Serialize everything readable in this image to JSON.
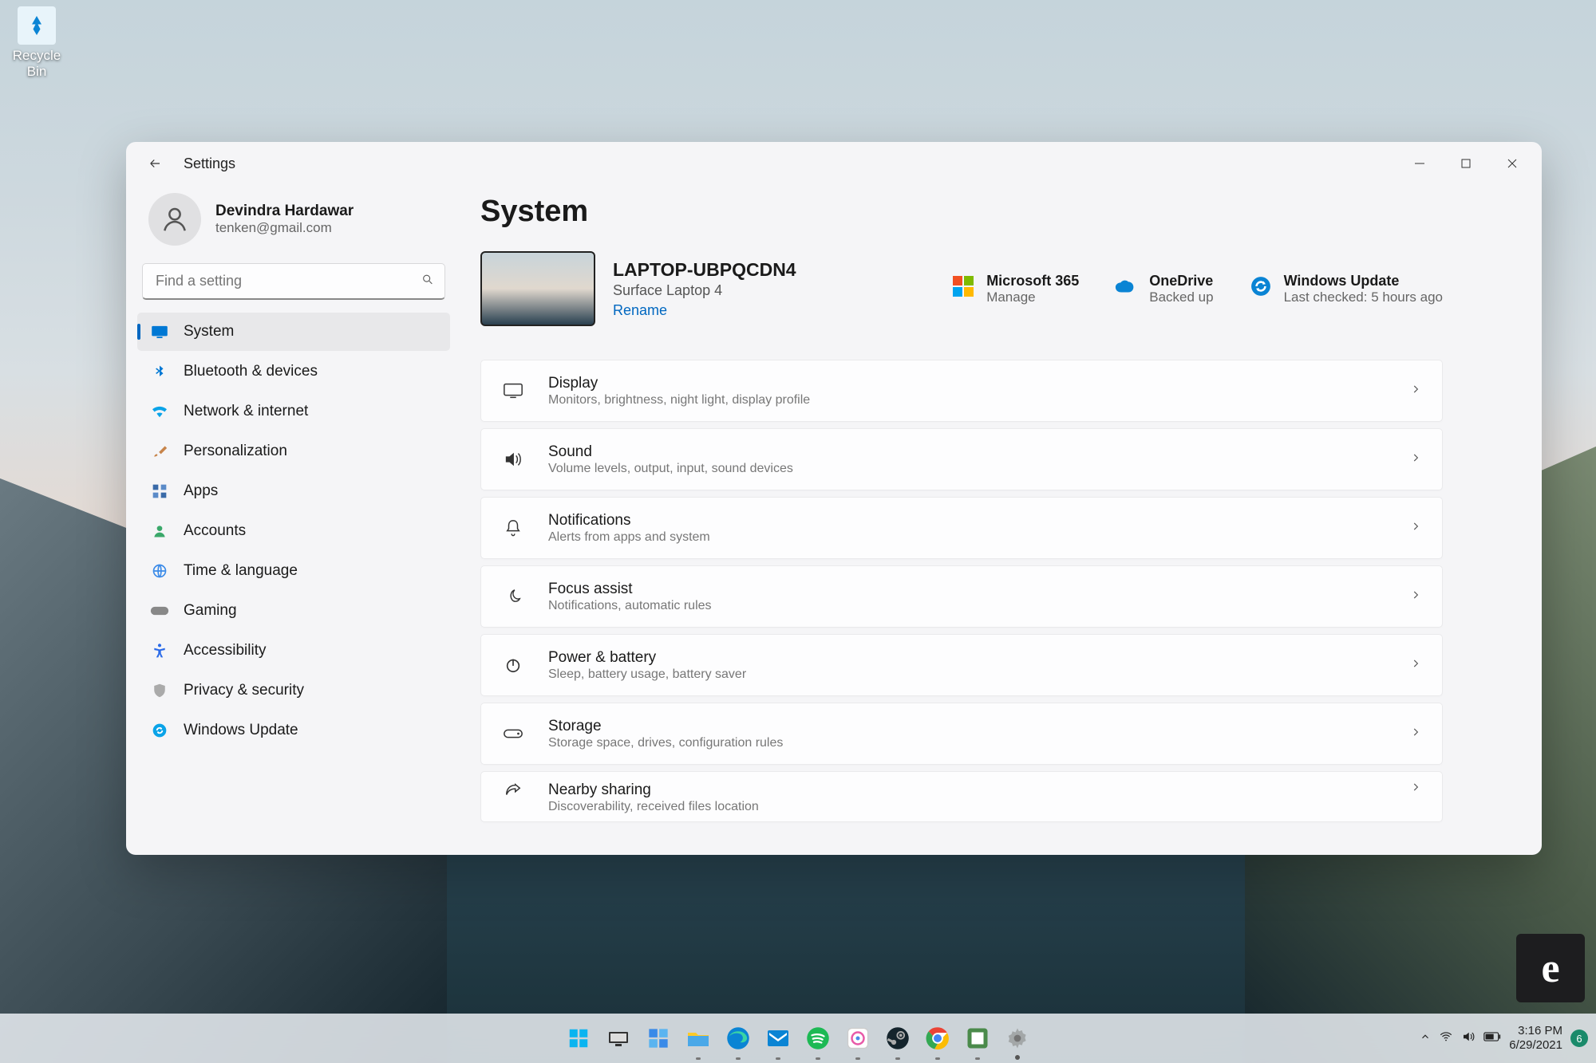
{
  "desktop": {
    "recycle_bin_label": "Recycle Bin"
  },
  "window": {
    "title": "Settings",
    "profile": {
      "name": "Devindra Hardawar",
      "email": "tenken@gmail.com"
    },
    "search_placeholder": "Find a setting",
    "nav": [
      {
        "label": "System",
        "icon": "system",
        "color": "#0078d4",
        "active": true
      },
      {
        "label": "Bluetooth & devices",
        "icon": "bluetooth",
        "color": "#0078d4"
      },
      {
        "label": "Network & internet",
        "icon": "wifi",
        "color": "#0aa3e8"
      },
      {
        "label": "Personalization",
        "icon": "brush",
        "color": "#c7844a"
      },
      {
        "label": "Apps",
        "icon": "apps",
        "color": "#3a6aa8"
      },
      {
        "label": "Accounts",
        "icon": "person",
        "color": "#3aa86a"
      },
      {
        "label": "Time & language",
        "icon": "globe",
        "color": "#3a8ae8"
      },
      {
        "label": "Gaming",
        "icon": "gamepad",
        "color": "#888"
      },
      {
        "label": "Accessibility",
        "icon": "accessibility",
        "color": "#2a6ae8"
      },
      {
        "label": "Privacy & security",
        "icon": "shield",
        "color": "#999"
      },
      {
        "label": "Windows Update",
        "icon": "update",
        "color": "#0aa3e8"
      }
    ],
    "main": {
      "heading": "System",
      "device": {
        "name": "LAPTOP-UBPQCDN4",
        "model": "Surface Laptop 4",
        "rename": "Rename"
      },
      "status": [
        {
          "title": "Microsoft 365",
          "sub": "Manage",
          "icon": "ms365"
        },
        {
          "title": "OneDrive",
          "sub": "Backed up",
          "icon": "onedrive"
        },
        {
          "title": "Windows Update",
          "sub": "Last checked: 5 hours ago",
          "icon": "update"
        }
      ],
      "cards": [
        {
          "title": "Display",
          "sub": "Monitors, brightness, night light, display profile",
          "icon": "display"
        },
        {
          "title": "Sound",
          "sub": "Volume levels, output, input, sound devices",
          "icon": "sound"
        },
        {
          "title": "Notifications",
          "sub": "Alerts from apps and system",
          "icon": "bell"
        },
        {
          "title": "Focus assist",
          "sub": "Notifications, automatic rules",
          "icon": "moon"
        },
        {
          "title": "Power & battery",
          "sub": "Sleep, battery usage, battery saver",
          "icon": "power"
        },
        {
          "title": "Storage",
          "sub": "Storage space, drives, configuration rules",
          "icon": "storage"
        },
        {
          "title": "Nearby sharing",
          "sub": "Discoverability, received files location",
          "icon": "share"
        }
      ]
    }
  },
  "taskbar": {
    "time": "3:16 PM",
    "date": "6/29/2021",
    "badge_count": "6",
    "apps": [
      "start",
      "taskview",
      "widgets",
      "explorer",
      "edge",
      "mail",
      "spotify",
      "app1",
      "steam",
      "chrome",
      "app2",
      "settings"
    ]
  },
  "ebadge": "e"
}
